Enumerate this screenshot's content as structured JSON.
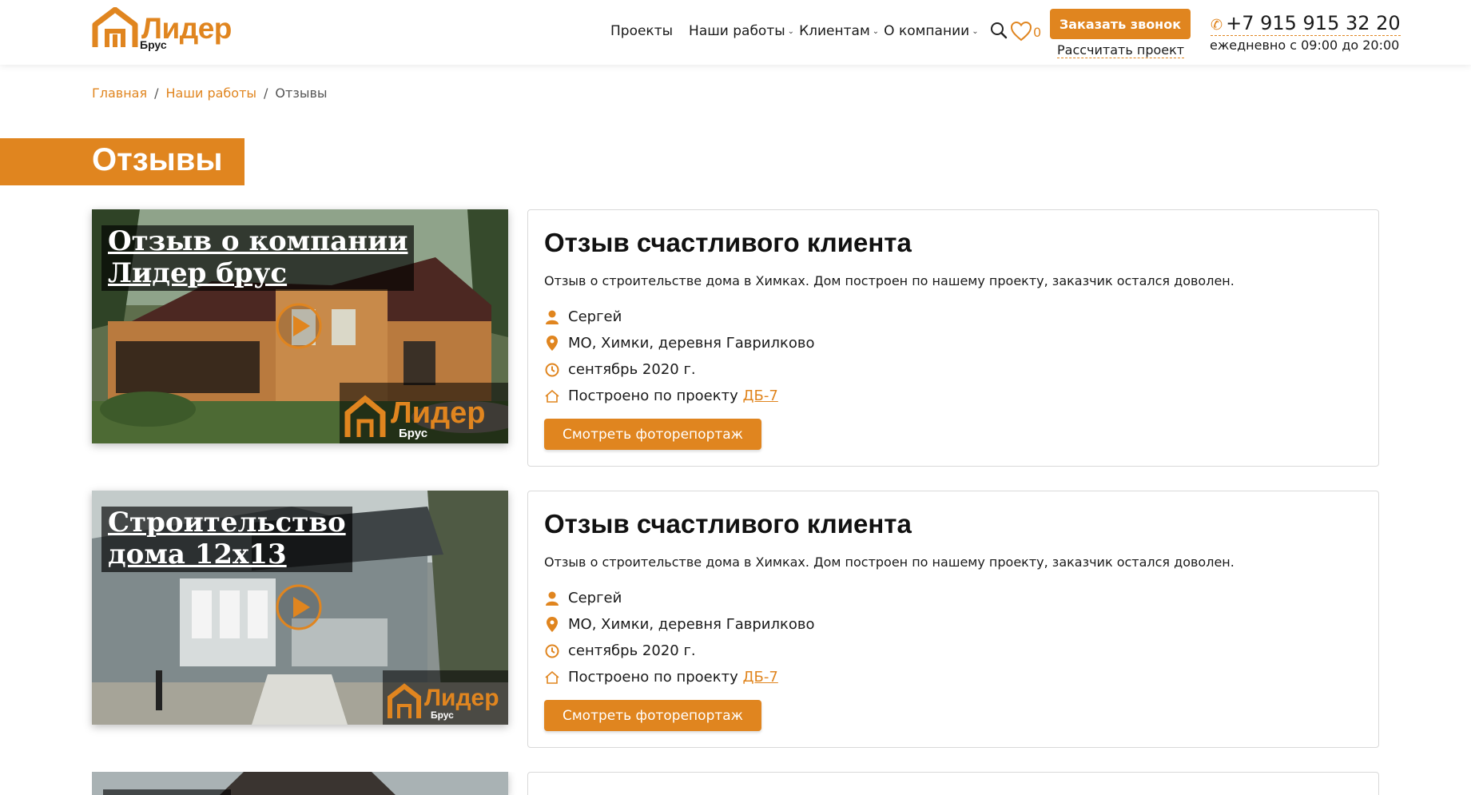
{
  "header": {
    "logo": {
      "word": "Лидер",
      "sub": "Брус"
    },
    "nav": [
      {
        "label": "Проекты",
        "dropdown": false
      },
      {
        "label": "Наши работы",
        "dropdown": true
      },
      {
        "label": "Клиентам",
        "dropdown": true
      },
      {
        "label": "О компании",
        "dropdown": true
      }
    ],
    "favorites_count": "0",
    "call_button": "Заказать звонок",
    "calc_link": "Рассчитать проект",
    "phone": "+7 915 915 32 20",
    "hours": "ежедневно с 09:00 до 20:00"
  },
  "breadcrumb": {
    "home": "Главная",
    "section": "Наши работы",
    "current": "Отзывы",
    "separator": "/"
  },
  "page_title": "Отзывы",
  "reviews": [
    {
      "video_caption_line1": "Отзыв о компании",
      "video_caption_line2": "Лидер брус",
      "title": "Отзыв счастливого клиента",
      "description": "Отзыв о строительстве дома в Химках. Дом построен по нашему проекту, заказчик остался доволен.",
      "name": "Сергей",
      "location": "МО, Химки, деревня Гаврилково",
      "date": "сентябрь 2020 г.",
      "project_prefix": "Построено по проекту",
      "project_link": "ДБ-7",
      "button": "Смотреть фоторепортаж"
    },
    {
      "video_caption_line1": "Строительство",
      "video_caption_line2": "дома 12x13",
      "title": "Отзыв счастливого клиента",
      "description": "Отзыв о строительстве дома в Химках. Дом построен по нашему проекту, заказчик остался доволен.",
      "name": "Сергей",
      "location": "МО, Химки, деревня Гаврилково",
      "date": "сентябрь 2020 г.",
      "project_prefix": "Построено по проекту",
      "project_link": "ДБ-7",
      "button": "Смотреть фоторепортаж"
    }
  ],
  "colors": {
    "accent": "#e0851f",
    "text": "#1a1a1a",
    "border": "#d9d9d9"
  },
  "icons": [
    "search-icon",
    "heart-icon",
    "phone-icon",
    "person-icon",
    "location-pin-icon",
    "clock-icon",
    "house-icon",
    "play-icon"
  ]
}
